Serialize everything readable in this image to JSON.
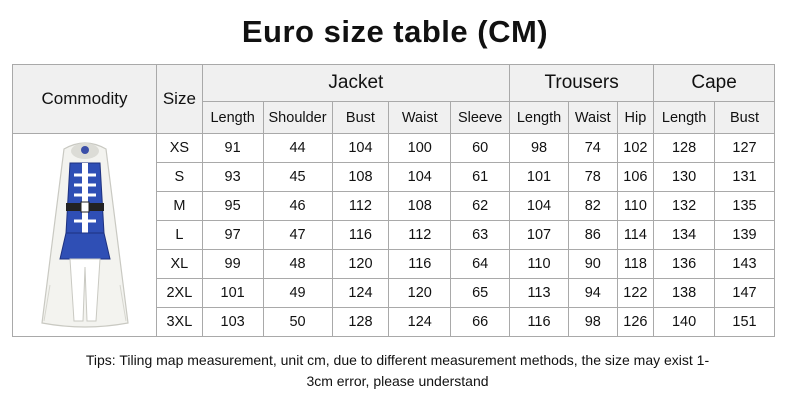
{
  "title": "Euro size table (CM)",
  "headers": {
    "commodity": "Commodity",
    "size": "Size",
    "groups": {
      "jacket": "Jacket",
      "trousers": "Trousers",
      "cape": "Cape"
    },
    "jacket_cols": [
      "Length",
      "Shoulder",
      "Bust",
      "Waist",
      "Sleeve"
    ],
    "trousers_cols": [
      "Length",
      "Waist",
      "Hip"
    ],
    "cape_cols": [
      "Length",
      "Bust"
    ]
  },
  "rows": [
    {
      "size": "XS",
      "jacket": [
        "91",
        "44",
        "104",
        "100",
        "60"
      ],
      "trousers": [
        "98",
        "74",
        "102"
      ],
      "cape": [
        "128",
        "127"
      ]
    },
    {
      "size": "S",
      "jacket": [
        "93",
        "45",
        "108",
        "104",
        "61"
      ],
      "trousers": [
        "101",
        "78",
        "106"
      ],
      "cape": [
        "130",
        "131"
      ]
    },
    {
      "size": "M",
      "jacket": [
        "95",
        "46",
        "112",
        "108",
        "62"
      ],
      "trousers": [
        "104",
        "82",
        "110"
      ],
      "cape": [
        "132",
        "135"
      ]
    },
    {
      "size": "L",
      "jacket": [
        "97",
        "47",
        "116",
        "112",
        "63"
      ],
      "trousers": [
        "107",
        "86",
        "114"
      ],
      "cape": [
        "134",
        "139"
      ]
    },
    {
      "size": "XL",
      "jacket": [
        "99",
        "48",
        "120",
        "116",
        "64"
      ],
      "trousers": [
        "110",
        "90",
        "118"
      ],
      "cape": [
        "136",
        "143"
      ]
    },
    {
      "size": "2XL",
      "jacket": [
        "101",
        "49",
        "124",
        "120",
        "65"
      ],
      "trousers": [
        "113",
        "94",
        "122"
      ],
      "cape": [
        "138",
        "147"
      ]
    },
    {
      "size": "3XL",
      "jacket": [
        "103",
        "50",
        "128",
        "124",
        "66"
      ],
      "trousers": [
        "116",
        "98",
        "126"
      ],
      "cape": [
        "140",
        "151"
      ]
    }
  ],
  "tips_line1": "Tips: Tiling map measurement, unit cm, due to different measurement methods, the size may exist 1-",
  "tips_line2": "3cm error, please understand",
  "colors": {
    "header_bg": "#f0f0f0",
    "border": "#a9a9a9",
    "jacket_blue": "#2f4fb5",
    "cape_white": "#f2f2ee"
  }
}
